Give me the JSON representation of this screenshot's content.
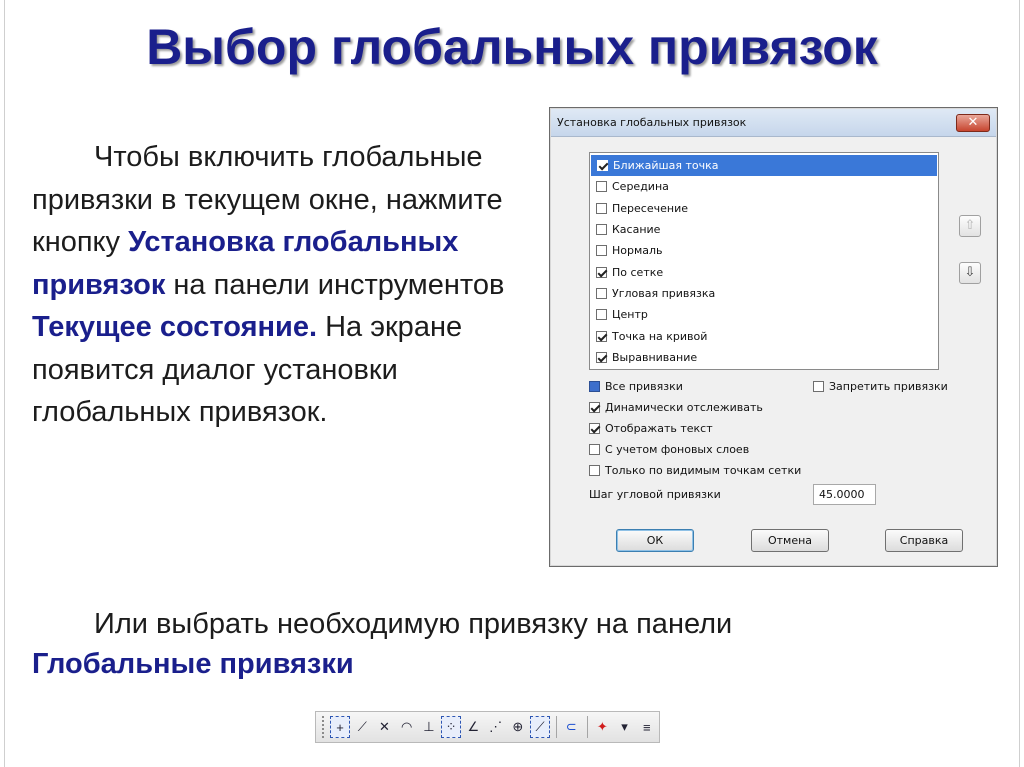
{
  "slide": {
    "title": "Выбор глобальных привязок",
    "para1": {
      "t1": "Чтобы включить глобальные привязки в текущем окне, нажмите кнопку ",
      "h1": "Установка глобальных привязок",
      "t2": " на панели инструментов ",
      "h2": "Текущее состояние.",
      "t3": " На экране появится диалог установки глобальных привязок."
    },
    "para2": {
      "t1": "Или выбрать необходимую привязку на панели ",
      "h1": "Глобальные привязки"
    }
  },
  "dialog": {
    "title": "Установка глобальных привязок",
    "close_label": "✕",
    "snaps": [
      {
        "label": "Ближайшая точка",
        "checked": true,
        "selected": true
      },
      {
        "label": "Середина",
        "checked": false
      },
      {
        "label": "Пересечение",
        "checked": false
      },
      {
        "label": "Касание",
        "checked": false
      },
      {
        "label": "Нормаль",
        "checked": false
      },
      {
        "label": "По сетке",
        "checked": true
      },
      {
        "label": "Угловая привязка",
        "checked": false
      },
      {
        "label": "Центр",
        "checked": false
      },
      {
        "label": "Точка на кривой",
        "checked": true
      },
      {
        "label": "Выравнивание",
        "checked": true
      }
    ],
    "move_up_icon": "arrow-up-icon",
    "move_down_icon": "arrow-down-icon",
    "options": {
      "all_snaps": "Все привязки",
      "forbid_snaps": "Запретить привязки",
      "dynamic_track": "Динамически отслеживать",
      "show_text": "Отображать текст",
      "background_layers": "С учетом фоновых слоев",
      "visible_grid_only": "Только по видимым точкам сетки"
    },
    "angle_step_label": "Шаг угловой привязки",
    "angle_step_value": "45.0000",
    "buttons": {
      "ok": "ОК",
      "cancel": "Отмена",
      "help": "Справка"
    }
  },
  "colors": {
    "accent": "#1a1f8c",
    "selection": "#3a78d8"
  }
}
